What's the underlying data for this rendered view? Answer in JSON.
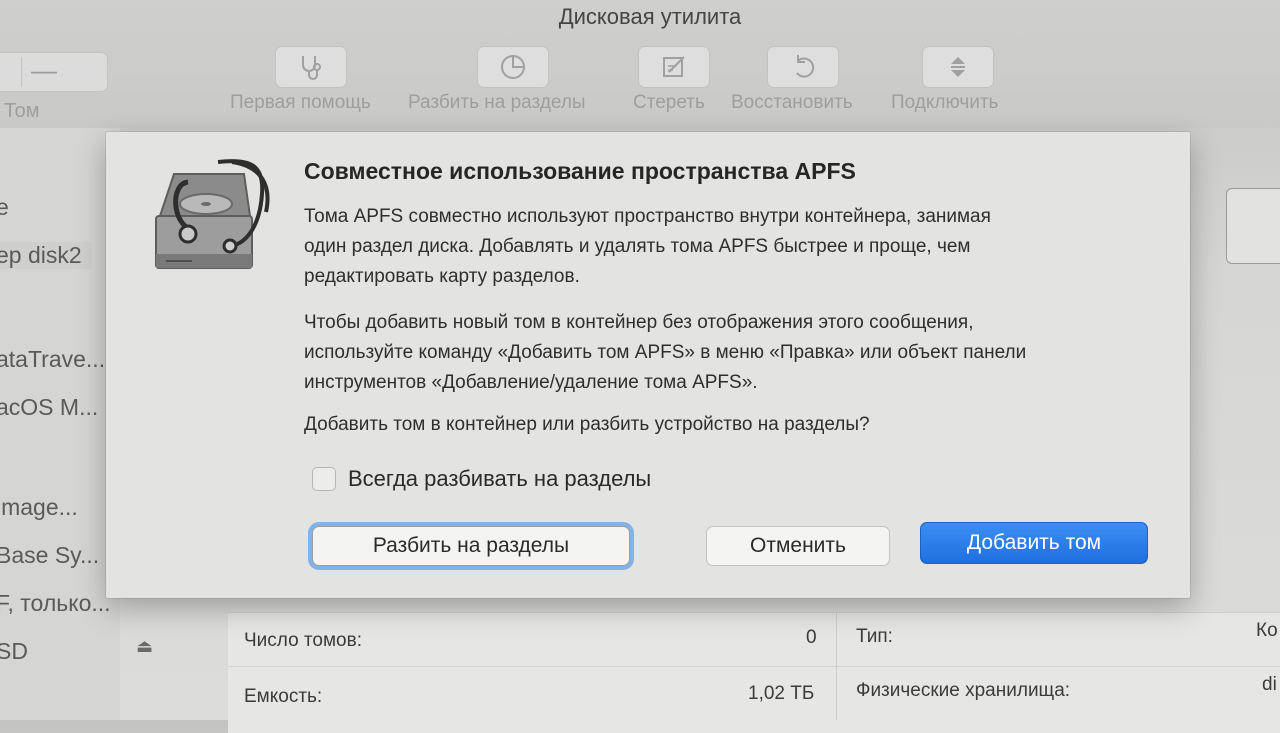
{
  "window": {
    "title": "Дисковая утилита"
  },
  "toolbar": {
    "volume_label": "Том",
    "minus_symbol": "—",
    "items": [
      {
        "label": "Первая помощь",
        "icon": "stethoscope-icon"
      },
      {
        "label": "Разбить на разделы",
        "icon": "pie-chart-icon"
      },
      {
        "label": "Стереть",
        "icon": "erase-icon"
      },
      {
        "label": "Восстановить",
        "icon": "restore-icon"
      },
      {
        "label": "Подключить",
        "icon": "mount-icon"
      }
    ]
  },
  "sidebar": {
    "items": [
      {
        "label": "e"
      },
      {
        "label": "ep disk2"
      },
      {
        "label": "ataTrave..."
      },
      {
        "label": "acOS M..."
      },
      {
        "label": "image..."
      },
      {
        "label": "Base Sy..."
      },
      {
        "label": "F, только..."
      },
      {
        "label": "SD"
      }
    ]
  },
  "info": {
    "volumes_label": "Число томов:",
    "volumes_value": "0",
    "capacity_label": "Емкость:",
    "capacity_value": "1,02 ТБ",
    "type_label": "Тип:",
    "type_value": "Ко",
    "stores_label": "Физические хранилища:",
    "stores_value": "di"
  },
  "dialog": {
    "title": "Совместное использование пространства APFS",
    "para1_line1": "Тома APFS совместно используют пространство внутри контейнера, занимая",
    "para1_line2": "один раздел диска. Добавлять и удалять тома APFS быстрее и проще, чем",
    "para1_line3": "редактировать карту разделов.",
    "para2_line1": "Чтобы добавить новый том в контейнер без отображения этого сообщения,",
    "para2_line2": "используйте команду «Добавить том APFS» в меню «Правка» или объект панели",
    "para2_line3": "инструментов «Добавление/удаление тома APFS».",
    "question": "Добавить том в контейнер или разбить устройство на разделы?",
    "checkbox_label": "Всегда разбивать на разделы",
    "checkbox_checked": false,
    "btn_partition": "Разбить на разделы",
    "btn_cancel": "Отменить",
    "btn_add": "Добавить том"
  },
  "colors": {
    "accent": "#1f6fe0",
    "focus_ring": "#7fb3ea"
  }
}
